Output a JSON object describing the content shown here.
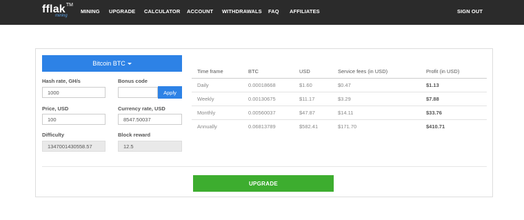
{
  "header": {
    "logo": {
      "name": "fflak",
      "tm": "TM",
      "sub": "mining"
    },
    "nav": [
      {
        "label": "MINING"
      },
      {
        "label": "UPGRADE"
      },
      {
        "label": "CALCULATOR"
      },
      {
        "label": "ACCOUNT"
      },
      {
        "label": "WITHDRAWALS"
      },
      {
        "label": "FAQ"
      },
      {
        "label": "AFFILIATES"
      }
    ],
    "signout_label": "SIGN OUT"
  },
  "calculator": {
    "coin_label": "Bitcoin BTC",
    "hash_rate": {
      "label": "Hash rate, GH/s",
      "value": "1000"
    },
    "bonus_code": {
      "label": "Bonus code",
      "value": "",
      "button": "Apply"
    },
    "price": {
      "label": "Price, USD",
      "value": "100"
    },
    "currency_rate": {
      "label": "Currency rate, USD",
      "value": "8547.50037"
    },
    "difficulty": {
      "label": "Difficulty",
      "value": "1347001430558.57"
    },
    "block_reward": {
      "label": "Block reward",
      "value": "12.5"
    }
  },
  "results": {
    "headers": [
      "Time frame",
      "BTC",
      "USD",
      "Service fees (in USD)",
      "Profit (in USD)"
    ],
    "rows": [
      [
        "Daily",
        "0.00018668",
        "$1.60",
        "$0.47",
        "$1.13"
      ],
      [
        "Weekly",
        "0.00130675",
        "$11.17",
        "$3.29",
        "$7.88"
      ],
      [
        "Monthly",
        "0.00560037",
        "$47.87",
        "$14.11",
        "$33.76"
      ],
      [
        "Annually",
        "0.06813789",
        "$582.41",
        "$171.70",
        "$410.71"
      ]
    ]
  },
  "upgrade_label": "UPGRADE",
  "colors": {
    "topbar": "#2b2b2b",
    "accent": "#2d82e6",
    "upgrade": "#3dad2f"
  }
}
